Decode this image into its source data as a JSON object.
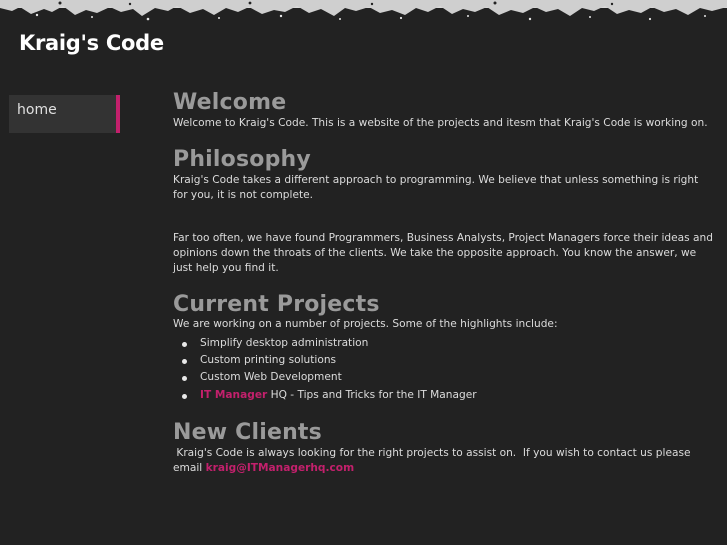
{
  "site": {
    "title": "Kraig's Code"
  },
  "nav": {
    "items": [
      {
        "label": "home"
      }
    ]
  },
  "welcome": {
    "heading": "Welcome",
    "text": "Welcome to Kraig's Code. This is a website of the projects and itesm that Kraig's Code is working on."
  },
  "philosophy": {
    "heading": "Philosophy",
    "p1": "Kraig's Code takes a different approach to programming. We believe that unless something is right for you, it is not complete.",
    "p2": "Far too often, we have found Programmers, Business Analysts, Project Managers force their ideas and opinions down the throats of the clients. We take the opposite approach. You know the answer, we just help you find it."
  },
  "projects": {
    "heading": "Current Projects",
    "intro": "We are working on a number of projects. Some of the highlights include:",
    "items": [
      "Simplify desktop administration",
      "Custom printing solutions",
      "Custom Web Development"
    ],
    "link_item": {
      "link_text": "IT Manager",
      "rest": " HQ - Tips and Tricks for the IT Manager"
    }
  },
  "clients": {
    "heading": "New Clients",
    "text": " Kraig's Code is always looking for the right projects to assist on.  If you wish to contact us please email ",
    "email": "kraig@ITManagerhq.com"
  },
  "colors": {
    "background": "#222222",
    "accent": "#c3206c",
    "heading": "#9a9a9a"
  }
}
